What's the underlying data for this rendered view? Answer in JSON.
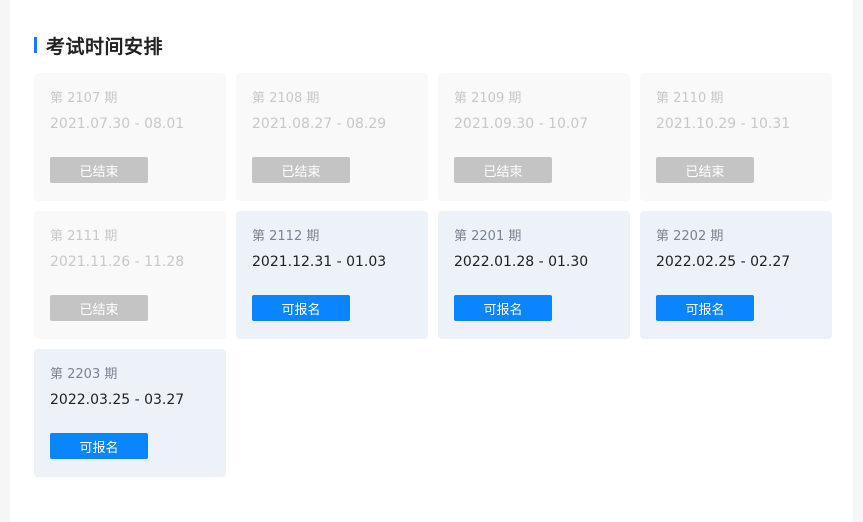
{
  "section": {
    "title": "考试时间安排"
  },
  "sessions": [
    {
      "period": "第 2107 期",
      "dates": "2021.07.30 - 08.01",
      "status": "ended",
      "button_label": "已结束"
    },
    {
      "period": "第 2108 期",
      "dates": "2021.08.27 - 08.29",
      "status": "ended",
      "button_label": "已结束"
    },
    {
      "period": "第 2109 期",
      "dates": "2021.09.30 - 10.07",
      "status": "ended",
      "button_label": "已结束"
    },
    {
      "period": "第 2110 期",
      "dates": "2021.10.29 - 10.31",
      "status": "ended",
      "button_label": "已结束"
    },
    {
      "period": "第 2111 期",
      "dates": "2021.11.26 - 11.28",
      "status": "ended",
      "button_label": "已结束"
    },
    {
      "period": "第 2112 期",
      "dates": "2021.12.31 - 01.03",
      "status": "open",
      "button_label": "可报名"
    },
    {
      "period": "第 2201 期",
      "dates": "2022.01.28 - 01.30",
      "status": "open",
      "button_label": "可报名"
    },
    {
      "period": "第 2202 期",
      "dates": "2022.02.25 - 02.27",
      "status": "open",
      "button_label": "可报名"
    },
    {
      "period": "第 2203 期",
      "dates": "2022.03.25 - 03.27",
      "status": "open",
      "button_label": "可报名"
    }
  ],
  "colors": {
    "accent": "#1677ff",
    "open_button": "#0a84ff",
    "ended_button": "#c4c4c4",
    "open_card": "#edf2f8",
    "ended_card": "#f9f9f9"
  }
}
